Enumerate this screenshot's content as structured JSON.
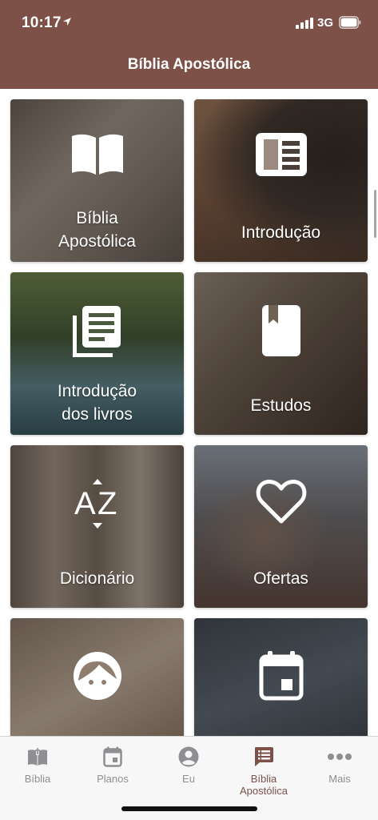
{
  "status_bar": {
    "time": "10:17",
    "network": "3G"
  },
  "nav": {
    "title": "Bíblia Apostólica"
  },
  "tiles": [
    {
      "label": "Bíblia\nApostólica",
      "icon": "open-book-icon"
    },
    {
      "label": "Introdução",
      "icon": "document-icon"
    },
    {
      "label": "Introdução\ndos livros",
      "icon": "book-list-icon"
    },
    {
      "label": "Estudos",
      "icon": "bookmark-book-icon"
    },
    {
      "label": "Dicionário",
      "icon": "a-z-sort-icon"
    },
    {
      "label": "Ofertas",
      "icon": "heart-icon"
    },
    {
      "label": "",
      "icon": "face-icon"
    },
    {
      "label": "",
      "icon": "calendar-icon"
    }
  ],
  "tabbar": {
    "tabs": [
      {
        "label": "Bíblia",
        "icon": "bible-icon",
        "active": false
      },
      {
        "label": "Planos",
        "icon": "calendar-icon",
        "active": false
      },
      {
        "label": "Eu",
        "icon": "person-icon",
        "active": false
      },
      {
        "label": "Bíblia Apostólica",
        "icon": "chat-list-icon",
        "active": true
      },
      {
        "label": "Mais",
        "icon": "more-dots-icon",
        "active": false
      }
    ]
  },
  "colors": {
    "header": "#7d5147",
    "active_tab": "#7d5147",
    "inactive_tab": "#8e8e93"
  }
}
